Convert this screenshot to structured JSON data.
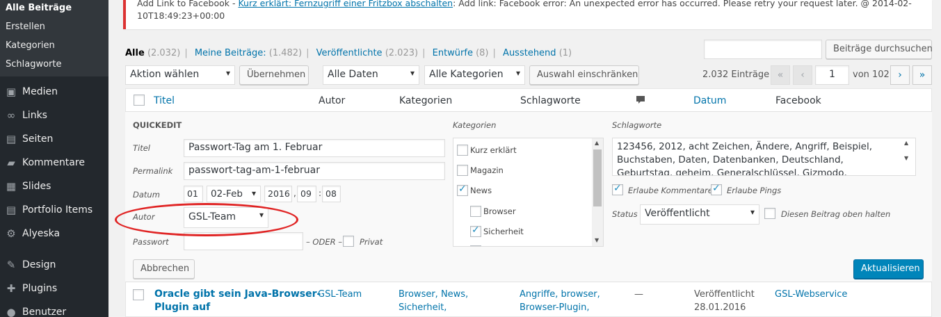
{
  "sidebar": {
    "submenu": [
      "Alle Beiträge",
      "Erstellen",
      "Kategorien",
      "Schlagworte"
    ],
    "menu": [
      {
        "label": "Medien",
        "icon": "media-icon"
      },
      {
        "label": "Links",
        "icon": "links-icon"
      },
      {
        "label": "Seiten",
        "icon": "pages-icon"
      },
      {
        "label": "Kommentare",
        "icon": "comments-icon"
      },
      {
        "label": "Slides",
        "icon": "slides-icon"
      },
      {
        "label": "Portfolio Items",
        "icon": "portfolio-icon"
      },
      {
        "label": "Alyeska",
        "icon": "gear-icon"
      },
      {
        "label": "Design",
        "icon": "brush-icon"
      },
      {
        "label": "Plugins",
        "icon": "plugin-icon"
      },
      {
        "label": "Benutzer",
        "icon": "user-icon"
      }
    ]
  },
  "notice": {
    "prefix": "Add Link to Facebook - ",
    "link": "Kurz erklärt: Fernzugriff einer Fritzbox abschalten",
    "suffix": ": Add link: Facebook error: An unexpected error has occurred. Please retry your request later. @ 2014-02-",
    "line2": "10T18:49:23+00:00"
  },
  "filters": {
    "all": "Alle",
    "all_count": "(2.032)",
    "mine": "Meine Beiträge:",
    "mine_count": "(1.482)",
    "published": "Veröffentlichte",
    "published_count": "(2.023)",
    "drafts": "Entwürfe",
    "drafts_count": "(8)",
    "pending": "Ausstehend",
    "pending_count": "(1)"
  },
  "search": {
    "value": "",
    "button": "Beiträge durchsuchen"
  },
  "toolbar": {
    "bulk_action": "Aktion wählen",
    "apply": "Übernehmen",
    "dates": "Alle Daten",
    "categories": "Alle Kategorien",
    "filter": "Auswahl einschränken",
    "entries": "2.032 Einträge",
    "first": "«",
    "prev": "‹",
    "page": "1",
    "of": "von 102",
    "next": "›",
    "last": "»"
  },
  "columns": {
    "title": "Titel",
    "author": "Autor",
    "categories": "Kategorien",
    "tags": "Schlagworte",
    "date": "Datum",
    "facebook": "Facebook"
  },
  "quickedit": {
    "heading": "QUICKEDIT",
    "title_label": "Titel",
    "title_value": "Passwort-Tag am 1. Februar",
    "permalink_label": "Permalink",
    "permalink_value": "passwort-tag-am-1-februar",
    "date_label": "Datum",
    "day": "01",
    "month": "02-Feb",
    "year": "2016",
    "hour": "09",
    "minute": "08",
    "author_label": "Autor",
    "author_value": "GSL-Team",
    "password_label": "Passwort",
    "password_value": "",
    "or": "– ODER –",
    "private": "Privat",
    "categories_label": "Kategorien",
    "categories": [
      {
        "name": "Kurz erklärt",
        "checked": false,
        "indent": false
      },
      {
        "name": "Magazin",
        "checked": false,
        "indent": false
      },
      {
        "name": "News",
        "checked": true,
        "indent": false
      },
      {
        "name": "Browser",
        "checked": false,
        "indent": true
      },
      {
        "name": "Sicherheit",
        "checked": true,
        "indent": true
      }
    ],
    "tags_label": "Schlagworte",
    "tags_value": "123456, 2012, acht Zeichen, Ändere, Angriff, Beispiel, Buchstaben, Daten, Datenbanken, Deutschland, Geburtstag, geheim, Generalschlüssel, Gizmodo, Lifehacker, Merksatz,",
    "allow_comments": "Erlaube Kommentare",
    "allow_pings": "Erlaube Pings",
    "status_label": "Status",
    "status_value": "Veröffentlicht",
    "sticky": "Diesen Beitrag oben halten",
    "cancel": "Abbrechen",
    "update": "Aktualisieren"
  },
  "row": {
    "title_line1": "Oracle gibt sein Java-Browser-",
    "title_line2": "Plugin auf",
    "author": "GSL-Team",
    "categories_line1": "Browser, News,",
    "categories_line2": "Sicherheit,",
    "tags_line1": "Angriffe, browser,",
    "tags_line2": "Browser-Plugin,",
    "comments": "—",
    "date_status": "Veröffentlicht",
    "date": "28.01.2016",
    "facebook": "GSL-Webservice"
  }
}
